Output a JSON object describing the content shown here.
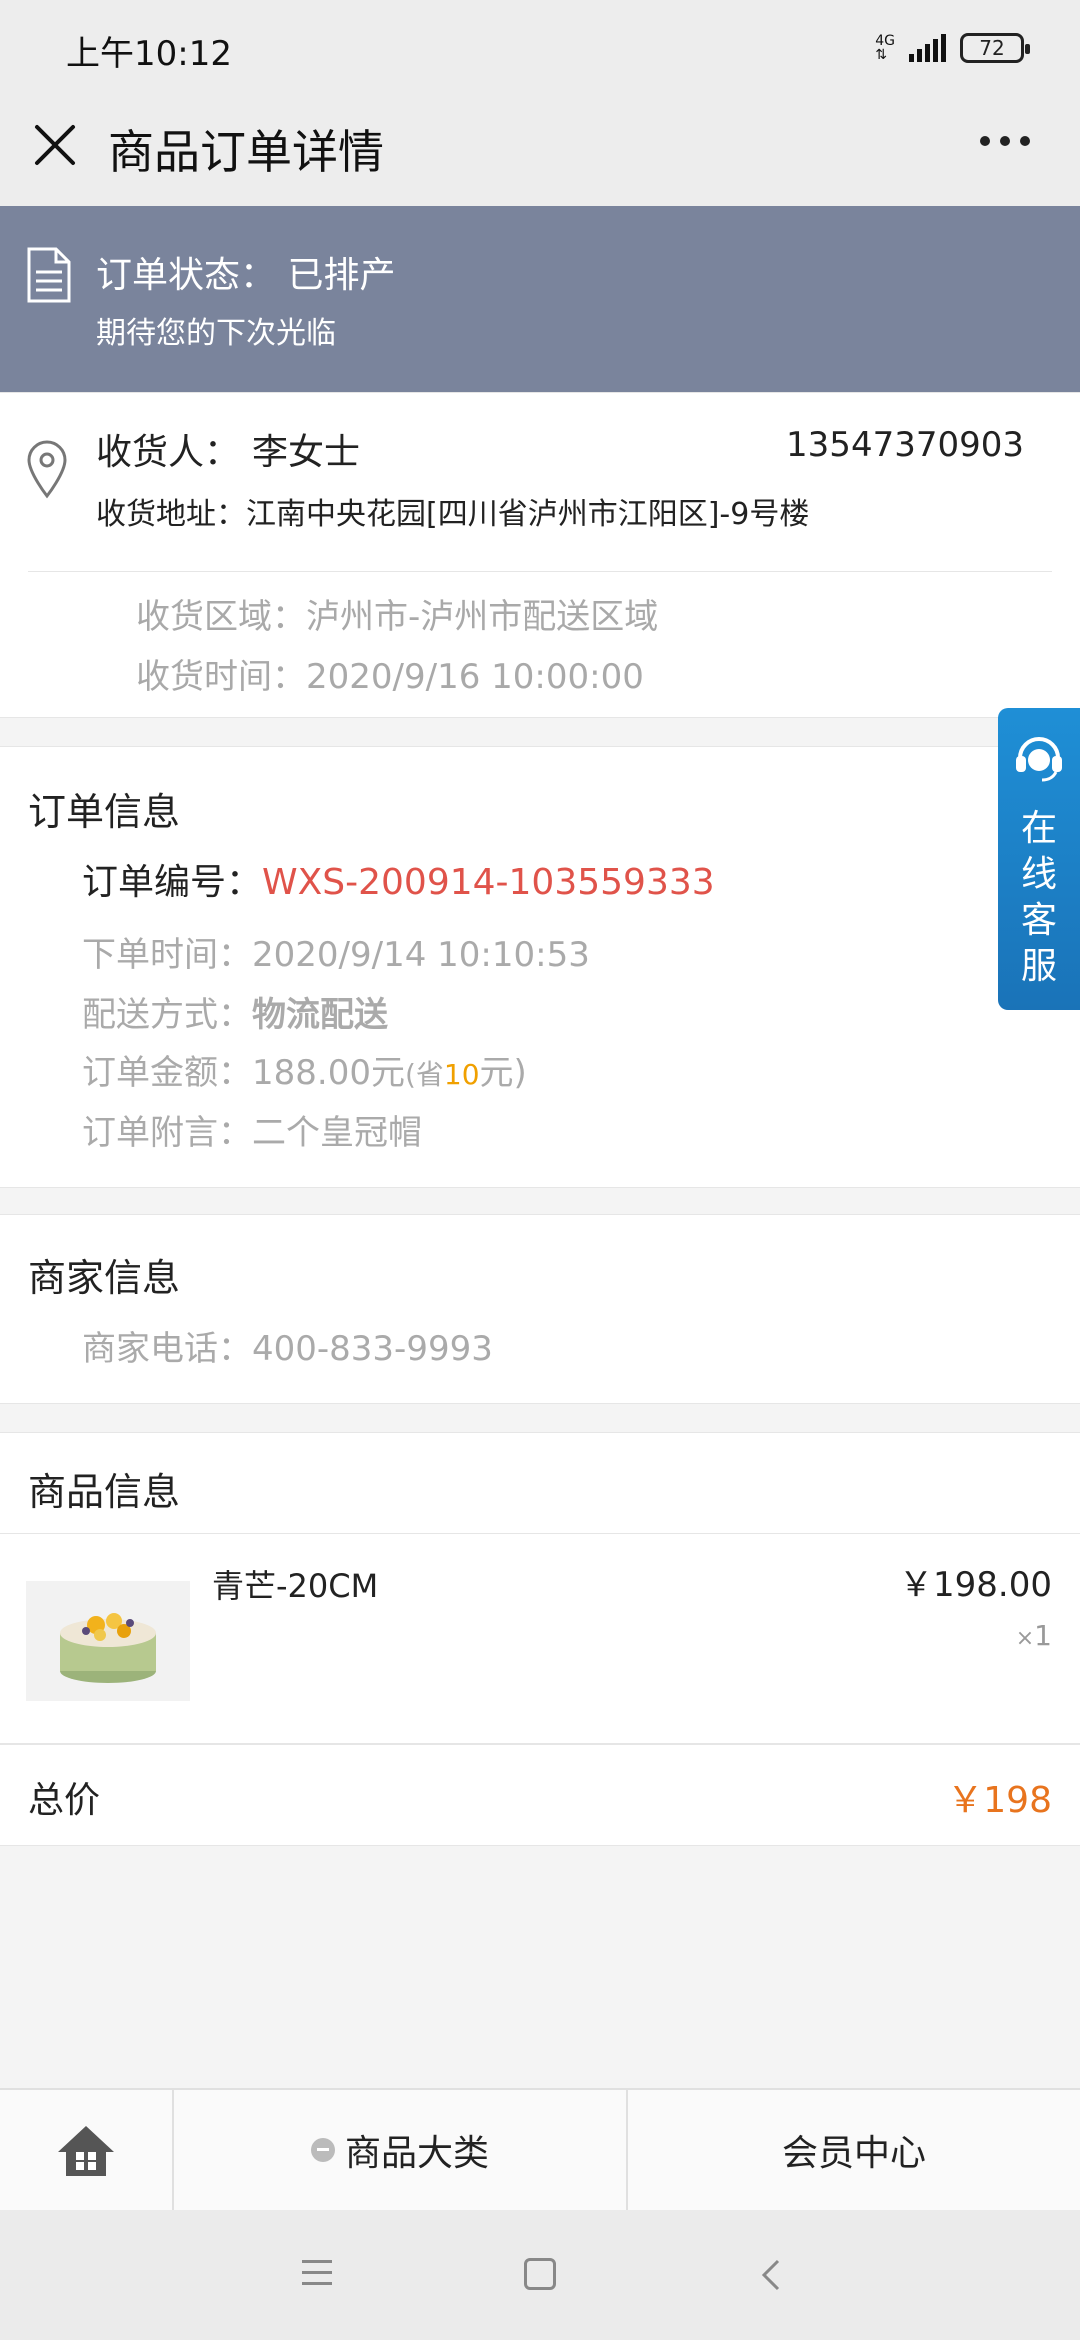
{
  "status_bar": {
    "time": "上午10:12",
    "network": "4G",
    "battery": "72"
  },
  "header": {
    "title": "商品订单详情"
  },
  "order_status": {
    "label": "订单状态：",
    "value": "已排产",
    "subtitle": "期待您的下次光临"
  },
  "delivery": {
    "receiver_label": "收货人：",
    "receiver_name": "李女士",
    "phone": "13547370903",
    "address_label": "收货地址：",
    "address": "江南中央花园[四川省泸州市江阳区]-9号楼",
    "region_label": "收货区域：",
    "region": "泸州市-泸州市配送区域",
    "time_label": "收货时间：",
    "time": "2020/9/16 10:00:00"
  },
  "order_info": {
    "title": "订单信息",
    "number_label": "订单编号：",
    "number": "WXS-200914-103559333",
    "created_label": "下单时间：",
    "created": "2020/9/14 10:10:53",
    "shipping_label": "配送方式：",
    "shipping": "物流配送",
    "amount_label": "订单金额：",
    "amount": "188.00元",
    "saved_prefix": "(省",
    "saved": "10",
    "saved_suffix": "元)",
    "note_label": "订单附言：",
    "note": "二个皇冠帽"
  },
  "merchant": {
    "title": "商家信息",
    "phone_label": "商家电话：",
    "phone": "400-833-9993"
  },
  "goods": {
    "title": "商品信息",
    "items": [
      {
        "name": "青芒-20CM",
        "price": "￥198.00",
        "qty_symbol": "×",
        "qty": "1"
      }
    ],
    "total_label": "总价",
    "total": "￥198"
  },
  "customer_service": {
    "label": "在线客服"
  },
  "bottom_nav": {
    "category": "商品大类",
    "member": "会员中心"
  },
  "colors": {
    "banner": "#7a849c",
    "order_number": "#e0534a",
    "saved": "#f0a000",
    "total": "#e8741e",
    "customer_service": "#1f8fd6"
  }
}
